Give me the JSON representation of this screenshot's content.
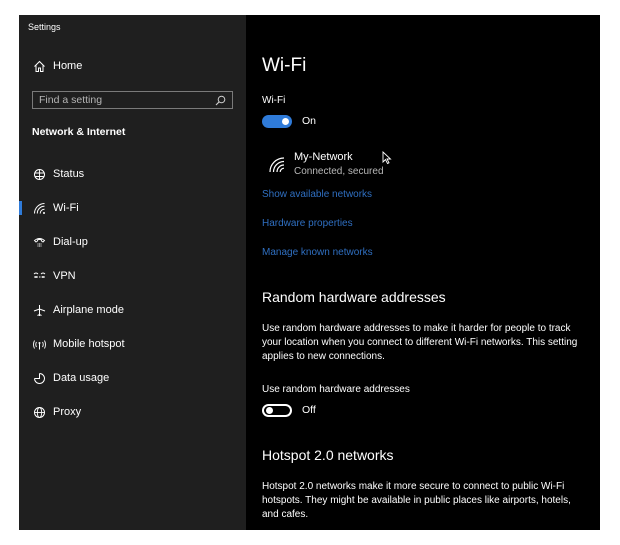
{
  "app": {
    "title": "Settings"
  },
  "sidebar": {
    "home": "Home",
    "search_placeholder": "Find a setting",
    "section_title": "Network & Internet",
    "items": [
      {
        "label": "Status",
        "icon": "globe-icon"
      },
      {
        "label": "Wi-Fi",
        "icon": "wifi-icon"
      },
      {
        "label": "Dial-up",
        "icon": "phone-icon"
      },
      {
        "label": "VPN",
        "icon": "vpn-icon"
      },
      {
        "label": "Airplane mode",
        "icon": "airplane-icon"
      },
      {
        "label": "Mobile hotspot",
        "icon": "hotspot-icon"
      },
      {
        "label": "Data usage",
        "icon": "data-usage-icon"
      },
      {
        "label": "Proxy",
        "icon": "proxy-icon"
      }
    ],
    "selected_item": "Wi-Fi"
  },
  "main": {
    "title": "Wi-Fi",
    "wifi_label": "Wi-Fi",
    "wifi_toggle": "On",
    "network": {
      "name": "My-Network",
      "status": "Connected, secured"
    },
    "links": [
      "Show available networks",
      "Hardware properties",
      "Manage known networks"
    ],
    "random_hw": {
      "heading": "Random hardware addresses",
      "description": "Use random hardware addresses to make it harder for people to track your location when you connect to different Wi-Fi networks. This setting applies to new connections.",
      "toggle_label": "Use random hardware addresses",
      "toggle_state": "Off"
    },
    "hotspot20": {
      "heading": "Hotspot 2.0 networks",
      "description": "Hotspot 2.0 networks make it more secure to connect to public Wi-Fi hotspots. They might be available in public places like airports, hotels, and cafes."
    }
  },
  "colors": {
    "accent": "#2f7bd9",
    "link": "#2f6fc1",
    "sidebar_bg": "#1f1f1f",
    "content_bg": "#000000"
  }
}
